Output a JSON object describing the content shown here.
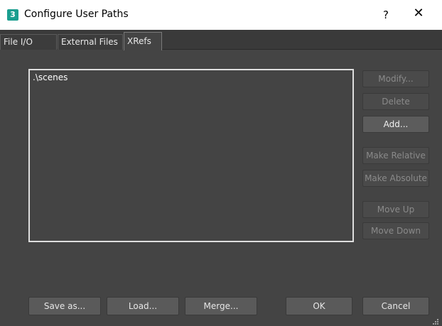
{
  "window": {
    "icon_text": "3",
    "title": "Configure User Paths",
    "help_label": "?",
    "close_label": "✕"
  },
  "tabs": [
    {
      "label": "File I/O"
    },
    {
      "label": "External Files"
    },
    {
      "label": "XRefs"
    }
  ],
  "active_tab": "XRefs",
  "paths": [
    ".\\scenes"
  ],
  "side_buttons": {
    "modify": "Modify...",
    "delete": "Delete",
    "add": "Add...",
    "make_relative": "Make Relative",
    "make_absolute": "Make Absolute",
    "move_up": "Move Up",
    "move_down": "Move Down"
  },
  "bottom_buttons": {
    "save_as": "Save as...",
    "load": "Load...",
    "merge": "Merge...",
    "ok": "OK",
    "cancel": "Cancel"
  },
  "colors": {
    "background": "#444444",
    "titlebar": "#ffffff",
    "app_icon": "#1a9e8f"
  }
}
